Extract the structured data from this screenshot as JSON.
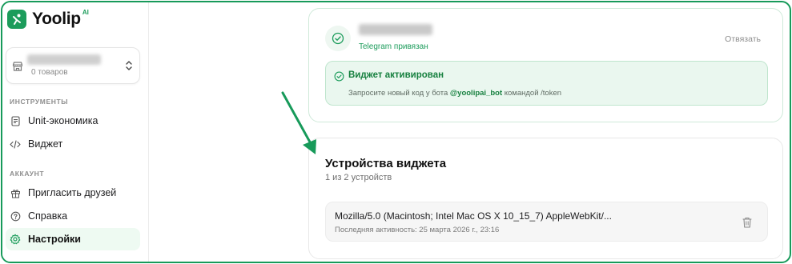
{
  "brand": {
    "name": "Yoolip",
    "badge": "AI",
    "accent": "#1c9c5b"
  },
  "store": {
    "count_label": "0 товаров"
  },
  "sidebar": {
    "sections": [
      {
        "title": "ИНСТРУМЕНТЫ",
        "items": [
          {
            "label": "Unit-экономика",
            "icon": "document-icon"
          },
          {
            "label": "Виджет",
            "icon": "code-icon"
          }
        ]
      },
      {
        "title": "АККАУНТ",
        "items": [
          {
            "label": "Пригласить друзей",
            "icon": "gift-icon"
          },
          {
            "label": "Справка",
            "icon": "help-icon"
          },
          {
            "label": "Настройки",
            "icon": "gear-icon",
            "active": true
          }
        ]
      }
    ]
  },
  "telegram": {
    "status": "Telegram привязан",
    "unlink_label": "Отвязать",
    "widget_title": "Виджет активирован",
    "widget_text_before": "Запросите новый код у бота ",
    "widget_bot": "@yoolipai_bot",
    "widget_text_after": " командой /token"
  },
  "devices": {
    "title": "Устройства виджета",
    "count": "1 из 2 устройств",
    "items": [
      {
        "user_agent": "Mozilla/5.0 (Macintosh; Intel Mac OS X 10_15_7) AppleWebKit/...",
        "last_seen": "Последняя активность: 25 марта 2026 г., 23:16"
      }
    ]
  },
  "annotation": {
    "arrow_color": "#179a5a"
  }
}
